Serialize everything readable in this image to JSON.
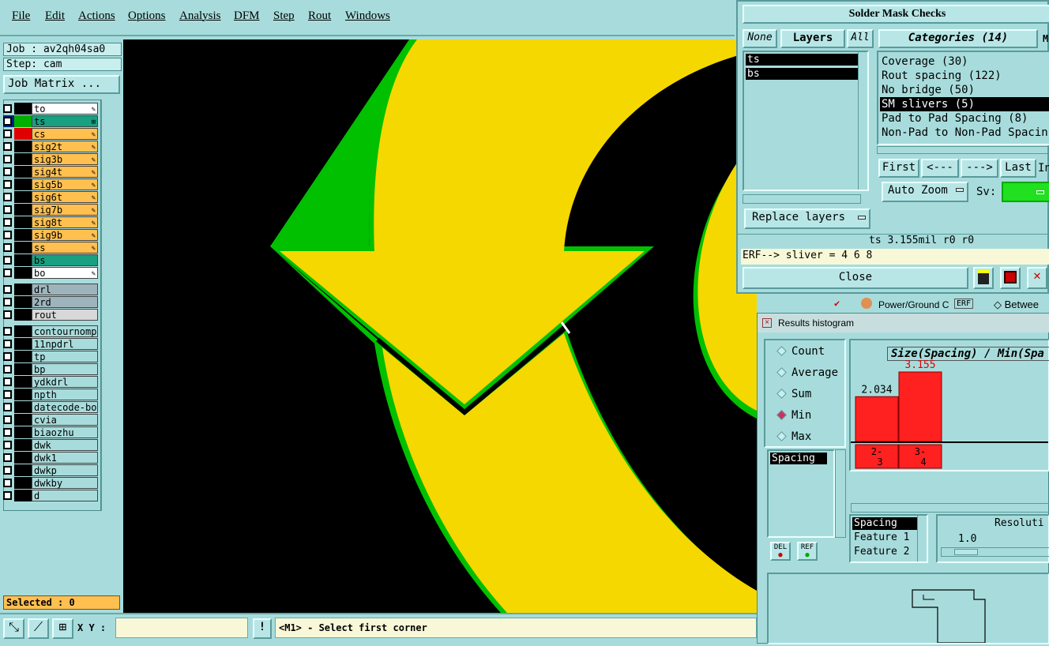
{
  "menu": [
    "File",
    "Edit",
    "Actions",
    "Options",
    "Analysis",
    "DFM",
    "Step",
    "Rout",
    "Windows"
  ],
  "left": {
    "job": "Job : av2qh04sa0",
    "step": "Step: cam",
    "job_matrix": "Job Matrix ...",
    "selected": "Selected : 0"
  },
  "layers": [
    {
      "name": "to",
      "style": "white",
      "color": "#000000",
      "mark": "✎"
    },
    {
      "name": "ts",
      "style": "teal",
      "color": "#00b000",
      "mark": "⊞"
    },
    {
      "name": "cs",
      "style": "orange",
      "color": "#e00000",
      "mark": "✎"
    },
    {
      "name": "sig2t",
      "style": "orange",
      "color": "#000000",
      "mark": "✎"
    },
    {
      "name": "sig3b",
      "style": "orange",
      "color": "#000000",
      "mark": "✎"
    },
    {
      "name": "sig4t",
      "style": "orange",
      "color": "#000000",
      "mark": "✎"
    },
    {
      "name": "sig5b",
      "style": "orange",
      "color": "#000000",
      "mark": "✎"
    },
    {
      "name": "sig6t",
      "style": "orange",
      "color": "#000000",
      "mark": "✎"
    },
    {
      "name": "sig7b",
      "style": "orange",
      "color": "#000000",
      "mark": "✎"
    },
    {
      "name": "sig8t",
      "style": "orange",
      "color": "#000000",
      "mark": "✎"
    },
    {
      "name": "sig9b",
      "style": "orange",
      "color": "#000000",
      "mark": "✎"
    },
    {
      "name": "ss",
      "style": "orange",
      "color": "#000000",
      "mark": "✎"
    },
    {
      "name": "bs",
      "style": "teal",
      "color": "#000000",
      "mark": ""
    },
    {
      "name": "bo",
      "style": "white",
      "color": "#000000",
      "mark": "✎"
    },
    {
      "name": "drl",
      "style": "gray",
      "color": "#000000",
      "mark": "",
      "gap": 1
    },
    {
      "name": "2rd",
      "style": "gray",
      "color": "#000000",
      "mark": ""
    },
    {
      "name": "rout",
      "style": "lightgray",
      "color": "#000000",
      "mark": ""
    },
    {
      "name": "contournomp",
      "style": "cyanl",
      "color": "#000000",
      "mark": "",
      "gap": 1
    },
    {
      "name": "11npdrl",
      "style": "cyanl",
      "color": "#000000",
      "mark": ""
    },
    {
      "name": "tp",
      "style": "cyanl",
      "color": "#000000",
      "mark": ""
    },
    {
      "name": "bp",
      "style": "cyanl",
      "color": "#000000",
      "mark": ""
    },
    {
      "name": "ydkdrl",
      "style": "cyanl",
      "color": "#000000",
      "mark": ""
    },
    {
      "name": "npth",
      "style": "cyanl",
      "color": "#000000",
      "mark": ""
    },
    {
      "name": "datecode-bo",
      "style": "cyanl",
      "color": "#000000",
      "mark": ""
    },
    {
      "name": "cvia",
      "style": "cyanl",
      "color": "#000000",
      "mark": ""
    },
    {
      "name": "biaozhu",
      "style": "cyanl",
      "color": "#000000",
      "mark": ""
    },
    {
      "name": "dwk",
      "style": "cyanl",
      "color": "#000000",
      "mark": ""
    },
    {
      "name": "dwk1",
      "style": "cyanl",
      "color": "#000000",
      "mark": ""
    },
    {
      "name": "dwkp",
      "style": "cyanl",
      "color": "#000000",
      "mark": ""
    },
    {
      "name": "dwkby",
      "style": "cyanl",
      "color": "#000000",
      "mark": ""
    },
    {
      "name": "d",
      "style": "cyanl",
      "color": "#000000",
      "mark": ""
    }
  ],
  "bottom": {
    "xy_label": "X Y :",
    "xy_value": "",
    "warn": "!",
    "prompt": "<M1> - Select first corner"
  },
  "sm": {
    "title": "Solder Mask Checks",
    "none": "None",
    "layers": "Layers",
    "all": "All",
    "categories": "Categories (14)",
    "cat_more": "Mo",
    "layer_items": [
      "ts",
      "bs"
    ],
    "cat_items": [
      "Coverage (30)",
      "Rout spacing (122)",
      "No bridge (50)",
      "SM slivers (5)",
      "Pad to Pad Spacing (8)",
      "Non-Pad to Non-Pad Spacin"
    ],
    "first": "First",
    "prev": "<---",
    "next": "--->",
    "last": "Last",
    "in": "In",
    "auto_zoom": "Auto Zoom",
    "sv": "Sv:",
    "replace": "Replace layers",
    "status": "ts 3.155mil  r0  r0",
    "erf": "ERF--> sliver = 4 6 8",
    "close": "Close"
  },
  "behind": {
    "tab1": "Power/Ground C",
    "erf": "ERF",
    "tab2": "Betwee"
  },
  "hist": {
    "title": "Results histogram",
    "radios": [
      {
        "label": "Count",
        "on": false
      },
      {
        "label": "Average",
        "on": false
      },
      {
        "label": "Sum",
        "on": false
      },
      {
        "label": "Min",
        "on": true
      },
      {
        "label": "Max",
        "on": false
      }
    ],
    "chart_title": "Size(Spacing) / Min(Spa",
    "spacing_list": "Spacing",
    "del": "DEL",
    "ref": "REF",
    "fields": [
      "Spacing",
      "Feature 1",
      "Feature 2"
    ],
    "resolution_label": "Resoluti",
    "resolution_value": "1.0"
  },
  "chart_data": {
    "type": "bar",
    "categories": [
      "2-3",
      "3-4"
    ],
    "category_lines": [
      [
        "2-",
        "3"
      ],
      [
        "3-",
        "4"
      ]
    ],
    "values": [
      2.034,
      3.155
    ],
    "value_labels": [
      "2.034",
      "3.155"
    ],
    "label_colors": [
      "#000000",
      "#e00000"
    ],
    "ylim": [
      0,
      3.155
    ]
  }
}
